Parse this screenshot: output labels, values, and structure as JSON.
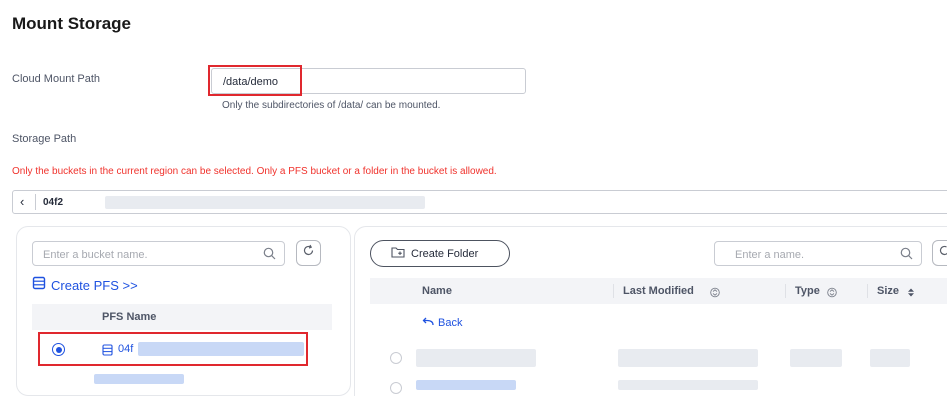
{
  "page_title": "Mount Storage",
  "cloud_mount_path": {
    "label": "Cloud Mount Path",
    "value": "/data/demo",
    "hint": "Only the subdirectories of /data/ can be mounted."
  },
  "storage_path": {
    "label": "Storage Path",
    "warning": "Only the buckets in the current region can be selected. Only a PFS bucket or a folder in the bucket is allowed.",
    "breadcrumb_value": "04f2"
  },
  "bucket_panel": {
    "search_placeholder": "Enter a bucket name.",
    "create_link": "Create PFS >>",
    "column_header": "PFS Name",
    "rows": [
      {
        "name": "04f",
        "selected": true
      }
    ]
  },
  "folder_panel": {
    "create_folder_label": "Create Folder",
    "search_placeholder": "Enter a name.",
    "columns": {
      "name": "Name",
      "last_modified": "Last Modified",
      "type": "Type",
      "size": "Size"
    },
    "back_label": "Back"
  },
  "colors": {
    "accent": "#1f52e0",
    "warning": "#f0322c",
    "highlight": "#e0282e"
  }
}
